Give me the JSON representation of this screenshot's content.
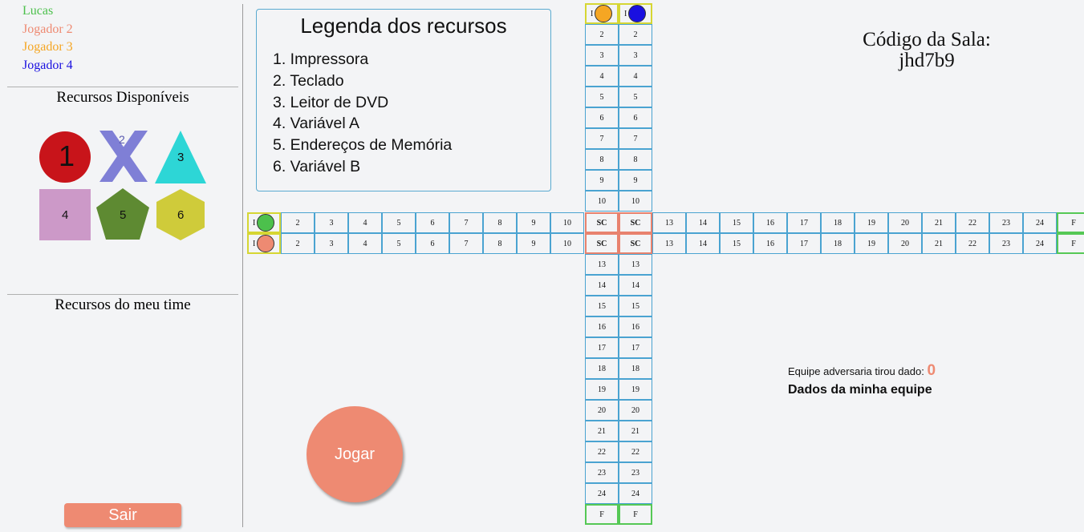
{
  "players": [
    {
      "name": "Lucas",
      "color": "#4cc04c"
    },
    {
      "name": "Jogador 2",
      "color": "#ee8a72"
    },
    {
      "name": "Jogador 3",
      "color": "#f5a623"
    },
    {
      "name": "Jogador 4",
      "color": "#1a10e0"
    }
  ],
  "sidebar": {
    "available_title": "Recursos Disponíveis",
    "team_title": "Recursos do meu time",
    "resources": [
      {
        "label": "1",
        "shape": "circle",
        "color": "#c8141a"
      },
      {
        "label": "2",
        "shape": "x",
        "color": "#7f7fd6"
      },
      {
        "label": "3",
        "shape": "triangle",
        "color": "#2dd6d6"
      },
      {
        "label": "4",
        "shape": "square",
        "color": "#cc99c8"
      },
      {
        "label": "5",
        "shape": "pentagon",
        "color": "#5e8a32"
      },
      {
        "label": "6",
        "shape": "hexagon",
        "color": "#cfcb3a"
      }
    ],
    "exit_label": "Sair"
  },
  "legend": {
    "title": "Legenda dos recursos",
    "items": [
      "1. Impressora",
      "2. Teclado",
      "3. Leitor de DVD",
      "4. Variável A",
      "5. Endereços de Memória",
      "6. Variável B"
    ]
  },
  "board": {
    "start_label": "I",
    "safe_label": "SC",
    "finish_label": "F",
    "arm_a": [
      "2",
      "3",
      "4",
      "5",
      "6",
      "7",
      "8",
      "9",
      "10"
    ],
    "arm_b": [
      "13",
      "14",
      "15",
      "16",
      "17",
      "18",
      "19",
      "20",
      "21",
      "22",
      "23",
      "24"
    ],
    "pawn_colors": {
      "green": "#4cc04c",
      "salmon": "#ee8a72",
      "orange": "#f5a623",
      "blue": "#1a10e0"
    }
  },
  "room": {
    "label": "Código da Sala:",
    "code": "jhd7b9"
  },
  "dice": {
    "adversary_label": "Equipe adversaria tirou dado:",
    "adversary_value": "0",
    "my_team_label": "Dados da minha equipe"
  },
  "play_label": "Jogar"
}
